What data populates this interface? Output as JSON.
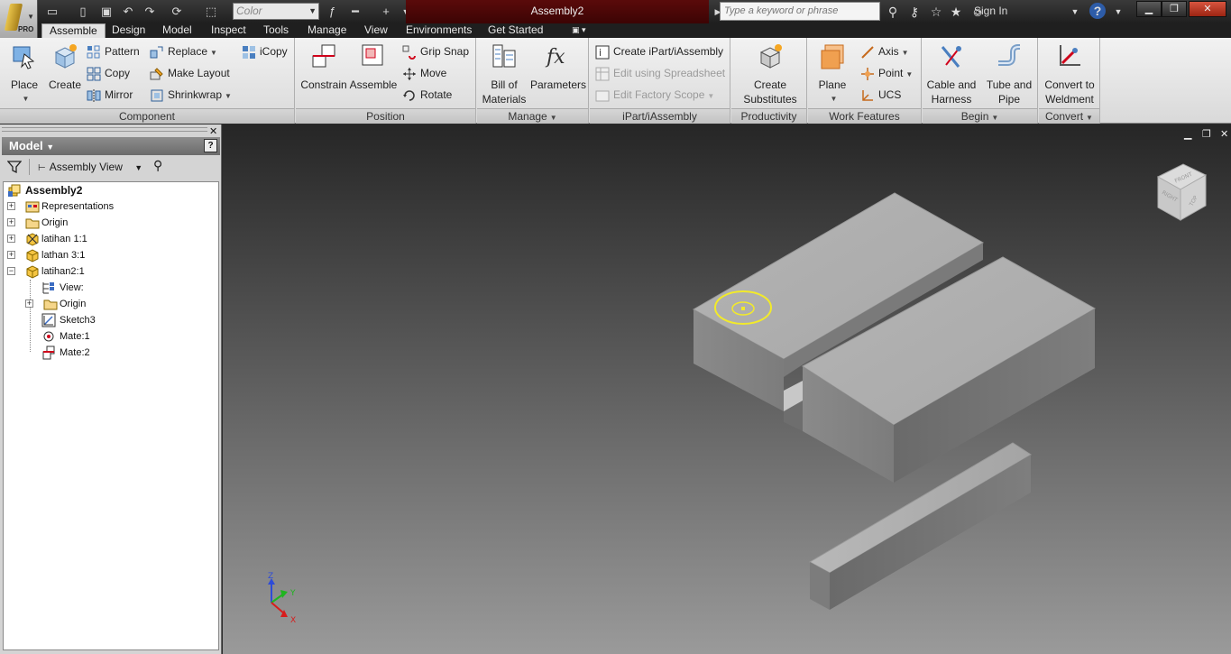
{
  "titlebar": {
    "document_title": "Assembly2",
    "color_combo_value": "Color",
    "search_placeholder": "Type a keyword or phrase",
    "signin_label": "Sign In",
    "help_label": "?"
  },
  "tabs": [
    {
      "label": "Assemble",
      "active": true
    },
    {
      "label": "Design",
      "active": false
    },
    {
      "label": "Model",
      "active": false
    },
    {
      "label": "Inspect",
      "active": false
    },
    {
      "label": "Tools",
      "active": false
    },
    {
      "label": "Manage",
      "active": false
    },
    {
      "label": "View",
      "active": false
    },
    {
      "label": "Environments",
      "active": false
    },
    {
      "label": "Get Started",
      "active": false
    }
  ],
  "ribbon": {
    "component": {
      "title": "Component",
      "place": "Place",
      "create": "Create",
      "pattern": "Pattern",
      "copy": "Copy",
      "mirror": "Mirror",
      "replace": "Replace",
      "make_layout": "Make Layout",
      "shrinkwrap": "Shrinkwrap",
      "icopy": "iCopy"
    },
    "position": {
      "title": "Position",
      "constrain": "Constrain",
      "assemble": "Assemble",
      "grip_snap": "Grip Snap",
      "move": "Move",
      "rotate": "Rotate"
    },
    "manage": {
      "title": "Manage",
      "bom_line1": "Bill of",
      "bom_line2": "Materials",
      "parameters": "Parameters"
    },
    "ipart": {
      "title": "iPart/iAssembly",
      "create": "Create iPart/iAssembly",
      "edit_spreadsheet": "Edit using Spreadsheet",
      "edit_factory": "Edit Factory Scope"
    },
    "productivity": {
      "title": "Productivity",
      "line1": "Create",
      "line2": "Substitutes"
    },
    "work_features": {
      "title": "Work Features",
      "plane": "Plane",
      "axis": "Axis",
      "point": "Point",
      "ucs": "UCS"
    },
    "begin": {
      "title": "Begin",
      "cable_line1": "Cable and",
      "cable_line2": "Harness",
      "tube_line1": "Tube and",
      "tube_line2": "Pipe"
    },
    "convert": {
      "title": "Convert",
      "line1": "Convert to",
      "line2": "Weldment"
    }
  },
  "browser": {
    "title": "Model",
    "view_selector": "Assembly View",
    "tree": [
      {
        "label": "Assembly2",
        "icon": "assembly-icon",
        "bold": true
      },
      {
        "label": "Representations",
        "icon": "representations-icon"
      },
      {
        "label": "Origin",
        "icon": "folder-icon"
      },
      {
        "label": "latihan 1:1",
        "icon": "part-grounded-icon"
      },
      {
        "label": "lathan 3:1",
        "icon": "part-icon"
      },
      {
        "label": "latihan2:1",
        "icon": "part-icon"
      },
      {
        "label": "View:",
        "icon": "view-icon"
      },
      {
        "label": "Origin",
        "icon": "folder-icon"
      },
      {
        "label": "Sketch3",
        "icon": "sketch-icon"
      },
      {
        "label": "Mate:1",
        "icon": "mate-icon"
      },
      {
        "label": "Mate:2",
        "icon": "mate-icon"
      }
    ]
  },
  "viewcube": {
    "face_top": "FRONT",
    "face_left": "RIGHT",
    "face_right": "TOP"
  },
  "triad": {
    "x": "X",
    "y": "Y",
    "z": "Z"
  },
  "colors": {
    "title_active": "#4a0808",
    "ribbon_bg": "#e4e4e4",
    "viewport_top": "#262626",
    "viewport_bottom": "#9a9a9a",
    "highlight_circle": "#f2ea2a"
  }
}
